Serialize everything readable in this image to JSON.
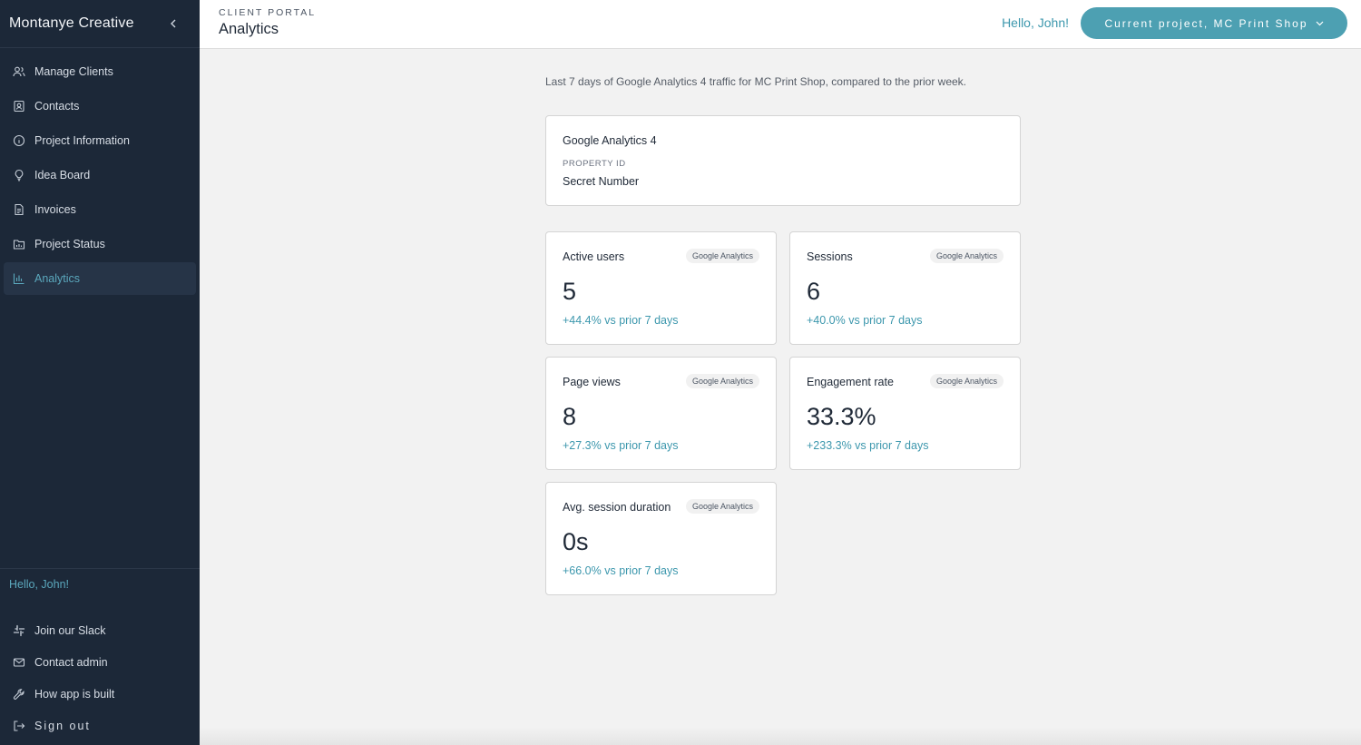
{
  "sidebar": {
    "brand": "Montanye Creative",
    "items": [
      {
        "label": "Manage Clients",
        "icon": "users-icon"
      },
      {
        "label": "Contacts",
        "icon": "contacts-icon"
      },
      {
        "label": "Project Information",
        "icon": "info-icon"
      },
      {
        "label": "Idea Board",
        "icon": "lightbulb-icon"
      },
      {
        "label": "Invoices",
        "icon": "document-icon"
      },
      {
        "label": "Project Status",
        "icon": "folder-icon"
      },
      {
        "label": "Analytics",
        "icon": "bar-chart-icon",
        "active": true
      }
    ],
    "greeting": "Hello, John!",
    "links": [
      {
        "label": "Join our Slack",
        "icon": "slack-icon"
      },
      {
        "label": "Contact admin",
        "icon": "mail-icon"
      },
      {
        "label": "How app is built",
        "icon": "wrench-icon"
      },
      {
        "label": "Sign out",
        "icon": "sign-out-icon"
      }
    ]
  },
  "header": {
    "eyebrow": "CLIENT PORTAL",
    "title": "Analytics",
    "greeting": "Hello, John!",
    "project_button": "Current project, MC Print Shop"
  },
  "main": {
    "intro": "Last 7 days of Google Analytics 4 traffic for MC Print Shop, compared to the prior week.",
    "ga_card": {
      "title": "Google Analytics 4",
      "property_label": "PROPERTY ID",
      "property_value": "Secret Number"
    },
    "metrics": [
      {
        "label": "Active users",
        "badge": "Google Analytics",
        "value": "5",
        "delta": "+44.4% vs prior 7 days"
      },
      {
        "label": "Sessions",
        "badge": "Google Analytics",
        "value": "6",
        "delta": "+40.0% vs prior 7 days"
      },
      {
        "label": "Page views",
        "badge": "Google Analytics",
        "value": "8",
        "delta": "+27.3% vs prior 7 days"
      },
      {
        "label": "Engagement rate",
        "badge": "Google Analytics",
        "value": "33.3%",
        "delta": "+233.3% vs prior 7 days"
      },
      {
        "label": "Avg. session duration",
        "badge": "Google Analytics",
        "value": "0s",
        "delta": "+66.0% vs prior 7 days"
      }
    ]
  },
  "colors": {
    "sidebar_bg": "#1c2838",
    "accent": "#3c97ad",
    "button_bg": "#4da0b2",
    "page_bg": "#f2f2f2"
  }
}
